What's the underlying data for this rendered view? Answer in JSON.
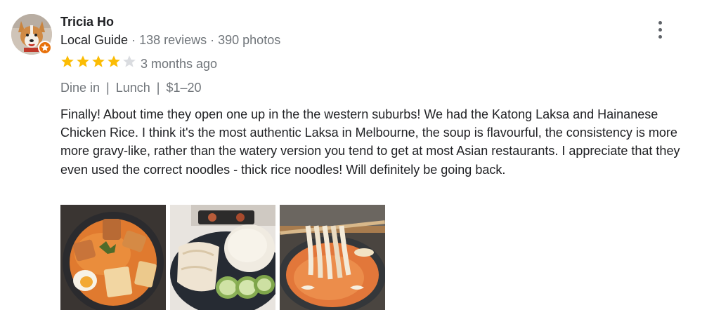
{
  "reviewer": {
    "name": "Tricia Ho",
    "badge": "Local Guide",
    "separator": " · ",
    "reviews": "138 reviews",
    "photos": "390 photos",
    "avatar_icon": "corgi-dog-avatar",
    "badge_icon": "local-guide-star-icon"
  },
  "review": {
    "rating": 4,
    "rating_max": 5,
    "time": "3 months ago",
    "tags": [
      "Dine in",
      "Lunch",
      "$1–20"
    ],
    "tag_separator": "|",
    "text": "Finally! About time they open one up in the the western suburbs! We had the Katong Laksa and Hainanese Chicken Rice. I think it's the most authentic Laksa in Melbourne, the soup is flavourful, the consistency is more more gravy-like, rather than the watery version you tend to get at most Asian restaurants. I appreciate that they even used the correct noodles - thick rice noodles! Will definitely be going back."
  },
  "photos": [
    {
      "subject": "laksa-bowl-photo"
    },
    {
      "subject": "hainanese-chicken-rice-photo"
    },
    {
      "subject": "laksa-noodles-chopsticks-photo"
    }
  ],
  "menu": {
    "icon": "more-vert-icon"
  },
  "colors": {
    "star_filled": "#fbbc04",
    "star_empty": "#dadce0",
    "text_primary": "#202124",
    "text_secondary": "#70757a",
    "badge_orange": "#e8710a"
  }
}
